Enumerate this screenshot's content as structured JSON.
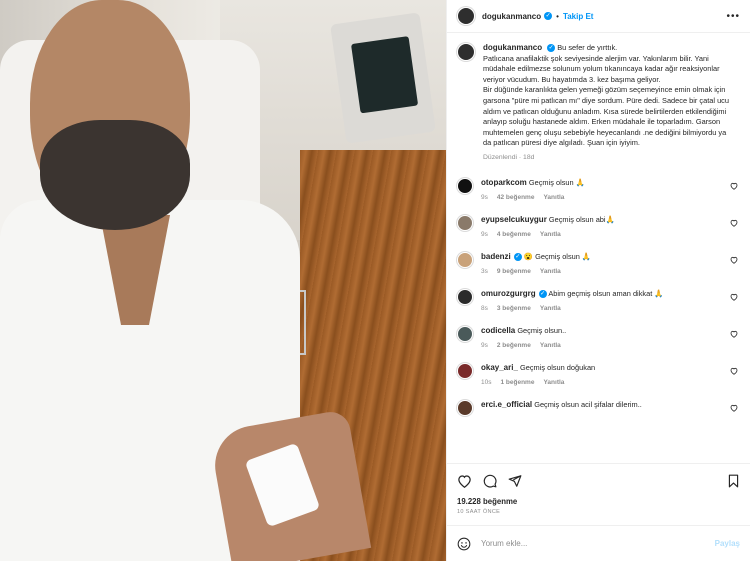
{
  "post": {
    "username": "dogukanmanco",
    "follow_label": "Takip Et",
    "more_label": "•••",
    "caption": "Bu sefer de yırttık.\nPatlıcana anafilaktik şok seviyesinde alerjim var. Yakınlarım bilir. Yani müdahale edilmezse solunum yolum tıkanıncaya kadar ağır reaksiyonlar veriyor vücudum. Bu hayatımda 3. kez başıma geliyor.\nBir düğünde karanlıkta gelen yemeği gözüm seçemeyince emin olmak için garsona \"püre mi patlıcan mı\" diye sordum. Püre dedi. Sadece bir çatal ucu aldım ve patlıcan olduğunu anladım. Kısa sürede belirtilerden etkilendiğimi anlayıp soluğu hastanede aldım. Erken müdahale ile toparladım. Garson muhtemelen genç oluşu sebebiyle heyecanlandı .ne dediğini bilmiyordu ya da patlıcan püresi diye algıladı. Şuan için iyiyim.",
    "edited": "Düzenlendi · 18d",
    "likes": "19.228 beğenme",
    "time": "10 SAAT ÖNCE"
  },
  "comments": [
    {
      "username": "otoparkcom",
      "text": "Geçmiş olsun 🙏",
      "time": "9s",
      "likes": "42 beğenme",
      "reply": "Yanıtla",
      "avatar_color": "#111111"
    },
    {
      "username": "eyupselcukuygur",
      "text": "Geçmiş olsun abi🙏",
      "time": "9s",
      "likes": "4 beğenme",
      "reply": "Yanıtla",
      "avatar_color": "#8a7a6a"
    },
    {
      "username": "badenzi",
      "text": "😮 Geçmiş olsun 🙏",
      "time": "3s",
      "likes": "9 beğenme",
      "reply": "Yanıtla",
      "avatar_color": "#c9a27a",
      "verified": true
    },
    {
      "username": "omurozgurgrg",
      "text": "Abim geçmiş olsun aman dikkat 🙏",
      "time": "8s",
      "likes": "3 beğenme",
      "reply": "Yanıtla",
      "avatar_color": "#2b2b2b",
      "verified": true
    },
    {
      "username": "codicella",
      "text": "Geçmiş olsun..",
      "time": "9s",
      "likes": "2 beğenme",
      "reply": "Yanıtla",
      "avatar_color": "#4a5a5a"
    },
    {
      "username": "okay_ari_",
      "text": "Geçmiş olsun doğukan",
      "time": "10s",
      "likes": "1 beğenme",
      "reply": "Yanıtla",
      "avatar_color": "#7a2a2a"
    },
    {
      "username": "erci.e_official",
      "text": "Geçmiş olsun acil şifalar dilerim..",
      "time": "",
      "likes": "",
      "reply": "",
      "avatar_color": "#5a3a2a"
    }
  ],
  "comment_box": {
    "placeholder": "Yorum ekle...",
    "post_label": "Paylaş"
  },
  "colors": {
    "link": "#0095f6",
    "muted": "#8e8e8e",
    "text": "#262626"
  },
  "icons": [
    "heart-icon",
    "comment-icon",
    "share-icon",
    "save-icon",
    "emoji-icon",
    "verified-icon"
  ]
}
